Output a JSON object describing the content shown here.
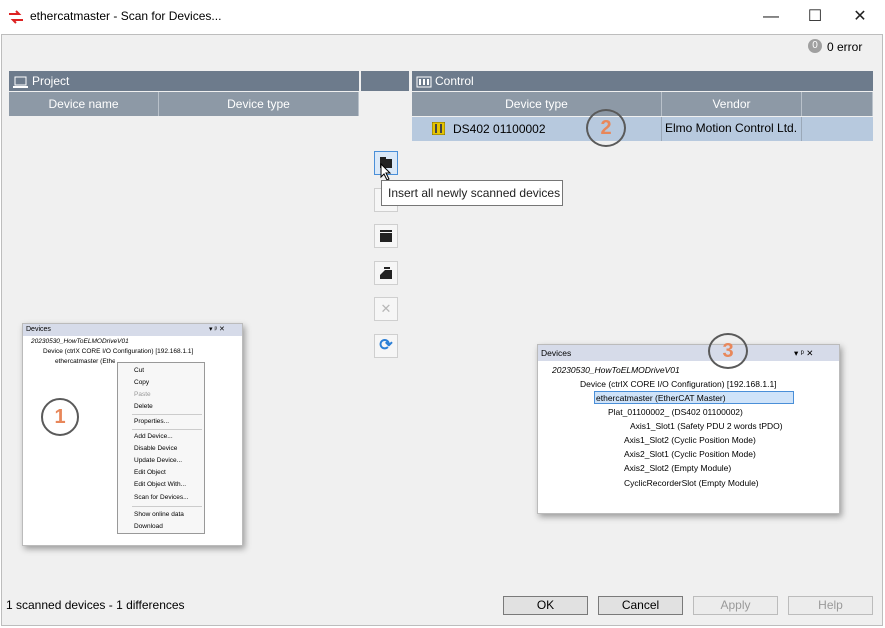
{
  "window": {
    "title": "ethercatmaster - Scan for Devices...",
    "minimize": "—",
    "maximize": "☐",
    "close": "✕"
  },
  "status": {
    "error_count": "0 error",
    "error_badge": "0"
  },
  "project": {
    "header": "Project",
    "columns": [
      "Device name",
      "Device type"
    ]
  },
  "control": {
    "header": "Control",
    "columns": [
      "Device type",
      "Vendor"
    ],
    "rows": [
      {
        "device_type": "DS402 01100002",
        "vendor": "Elmo Motion Control Ltd."
      }
    ]
  },
  "toolbar": {
    "tooltip": "Insert all newly scanned devices",
    "delete_glyph": "✕",
    "refresh_glyph": "⟳"
  },
  "annotations": [
    "1",
    "2",
    "3"
  ],
  "shot1": {
    "panel_title": "Devices",
    "panel_controls": "▾ ᵖ ✕",
    "tree": [
      "20230530_HowToELMODriveV01",
      "Device (ctrlX CORE I/O Configuration) [192.168.1.1]",
      "ethercatmaster (EtherCAT Master)"
    ],
    "menu": [
      "Cut",
      "Copy",
      "Paste",
      "Delete",
      "Properties...",
      "Add Device...",
      "Disable Device",
      "Update Device...",
      "Edit Object",
      "Edit Object With...",
      "Scan for Devices...",
      "Show online data",
      "Download"
    ]
  },
  "shot3": {
    "panel_title": "Devices",
    "panel_controls": "▾ ᵖ ✕",
    "tree": [
      "20230530_HowToELMODriveV01",
      "Device (ctrlX CORE I/O Configuration) [192.168.1.1]",
      "ethercatmaster (EtherCAT Master)",
      "Plat_01100002_ (DS402 01100002)",
      "Axis1_Slot1 (Safety PDU 2 words tPDO)",
      "Axis1_Slot2 (Cyclic Position Mode)",
      "Axis2_Slot1 (Cyclic Position Mode)",
      "Axis2_Slot2 (Empty Module)",
      "CyclicRecorderSlot (Empty Module)"
    ]
  },
  "footer": {
    "summary": "1 scanned devices - 1 differences",
    "ok": "OK",
    "cancel": "Cancel",
    "apply": "Apply",
    "help": "Help"
  }
}
